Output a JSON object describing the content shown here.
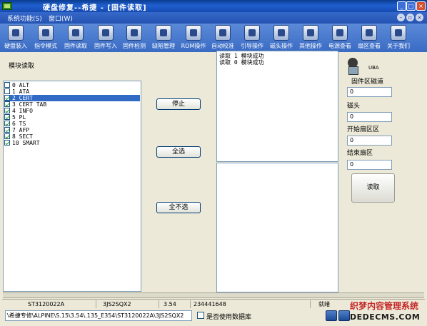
{
  "window": {
    "title": "硬盘修复--希捷 - [固件读取]"
  },
  "menubar": {
    "items": [
      "系统功能(S)",
      "窗口(W)"
    ]
  },
  "toolbar": {
    "items": [
      {
        "label": "硬盘装入",
        "icon": "disk-load-icon"
      },
      {
        "label": "指令模式",
        "icon": "command-icon"
      },
      {
        "label": "固件读取",
        "icon": "firmware-read-icon"
      },
      {
        "label": "固件写入",
        "icon": "firmware-write-icon"
      },
      {
        "label": "固件检测",
        "icon": "firmware-check-icon"
      },
      {
        "label": "缺陷管理",
        "icon": "defect-tools-icon"
      },
      {
        "label": "ROM操作",
        "icon": "rom-icon"
      },
      {
        "label": "自动校准",
        "icon": "auto-calibrate-icon"
      },
      {
        "label": "引导操作",
        "icon": "boot-icon"
      },
      {
        "label": "磁头操作",
        "icon": "head-icon"
      },
      {
        "label": "其他操作",
        "icon": "other-icon"
      },
      {
        "label": "电源查看",
        "icon": "power-icon"
      },
      {
        "label": "扇区查看",
        "icon": "sector-icon"
      },
      {
        "label": "关于我们",
        "icon": "about-icon"
      }
    ]
  },
  "module_panel": {
    "label": "模块读取",
    "items": [
      {
        "text": "0 ALT",
        "checked": false,
        "selected": false
      },
      {
        "text": "1 ATA",
        "checked": false,
        "selected": false
      },
      {
        "text": "2 CERT",
        "checked": true,
        "selected": true
      },
      {
        "text": "3 CERT TAB",
        "checked": true,
        "selected": false
      },
      {
        "text": "4 INFO",
        "checked": true,
        "selected": false
      },
      {
        "text": "5 PL",
        "checked": true,
        "selected": false
      },
      {
        "text": "6 TS",
        "checked": true,
        "selected": false
      },
      {
        "text": "7 AFP",
        "checked": true,
        "selected": false
      },
      {
        "text": "8 SECT",
        "checked": true,
        "selected": false
      },
      {
        "text": "10 SMART",
        "checked": true,
        "selected": false
      }
    ]
  },
  "buttons": {
    "stop": "停止",
    "select_all": "全选",
    "select_none": "全不选",
    "read": "读取"
  },
  "log": {
    "lines": [
      "读取 1 模块成功",
      "读取 0 模块成功"
    ]
  },
  "right_panel": {
    "uba_label": "UBA",
    "firmware_track_label": "固件区磁道",
    "firmware_track_value": "0",
    "head_label": "磁头",
    "head_value": "0",
    "start_sector_label": "开始扇区区",
    "start_sector_value": "0",
    "end_sector_label": "结束扇区",
    "end_sector_value": "0"
  },
  "statusbar": {
    "model": "ST3120022A",
    "serial": "3JS2SQX2",
    "firmware": "3.54",
    "capacity": "234441648",
    "state": "就绪"
  },
  "bottom": {
    "path": "\\希捷专修\\ALPINE\\S.15\\3.54\\.135_E354\\ST3120022A\\3JS2SQX2",
    "use_db_label": "是否使用数据库"
  },
  "watermark": {
    "line1": "织梦内容管理系统",
    "line2": "DEDECMS.COM"
  }
}
